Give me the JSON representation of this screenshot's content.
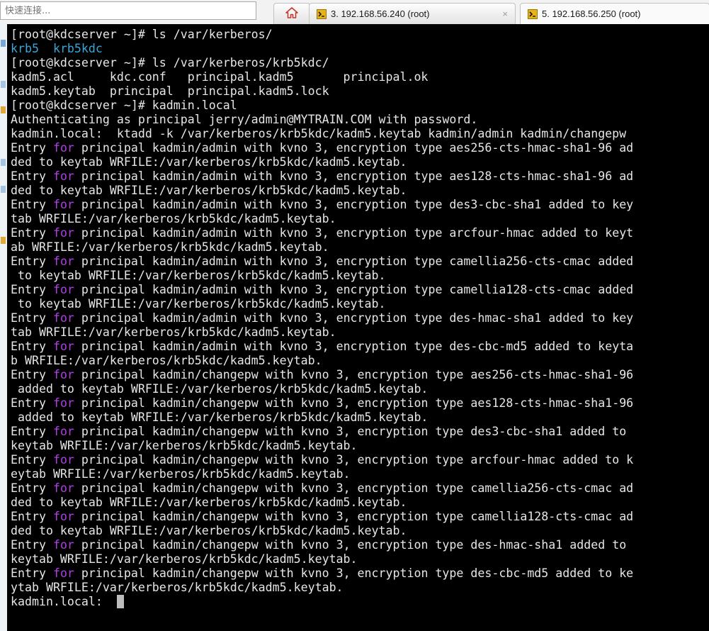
{
  "quick_connect": {
    "placeholder": "快速连接..."
  },
  "tabs": [
    {
      "label": "",
      "icon": "home-icon"
    },
    {
      "label": "3. 192.168.56.240 (root)",
      "icon": "terminal-tab-icon",
      "close": "×"
    },
    {
      "label": "5. 192.168.56.250 (root)",
      "icon": "terminal-tab-icon",
      "active": true
    }
  ],
  "terminal": {
    "lines": [
      [
        [
          "p",
          "[root@kdcserver ~]# ls /var/kerberos/"
        ]
      ],
      [
        [
          "d",
          "krb5"
        ],
        [
          "p",
          "  "
        ],
        [
          "d",
          "krb5kdc"
        ]
      ],
      [
        [
          "p",
          "[root@kdcserver ~]# ls /var/kerberos/krb5kdc/"
        ]
      ],
      [
        [
          "p",
          "kadm5.acl     kdc.conf   principal.kadm5       principal.ok"
        ]
      ],
      [
        [
          "p",
          "kadm5.keytab  principal  principal.kadm5.lock"
        ]
      ],
      [
        [
          "p",
          "[root@kdcserver ~]# kadmin.local"
        ]
      ],
      [
        [
          "p",
          "Authenticating as principal jerry/admin@MYTRAIN.COM with password."
        ]
      ],
      [
        [
          "p",
          "kadmin.local:  ktadd -k /var/kerberos/krb5kdc/kadm5.keytab kadmin/admin kadmin/changepw"
        ]
      ],
      [
        [
          "p",
          "Entry "
        ],
        [
          "k",
          "for"
        ],
        [
          "p",
          " principal kadmin/admin with kvno 3, encryption type aes256-cts-hmac-sha1-96 ad"
        ]
      ],
      [
        [
          "p",
          "ded to keytab WRFILE:/var/kerberos/krb5kdc/kadm5.keytab."
        ]
      ],
      [
        [
          "p",
          "Entry "
        ],
        [
          "k",
          "for"
        ],
        [
          "p",
          " principal kadmin/admin with kvno 3, encryption type aes128-cts-hmac-sha1-96 ad"
        ]
      ],
      [
        [
          "p",
          "ded to keytab WRFILE:/var/kerberos/krb5kdc/kadm5.keytab."
        ]
      ],
      [
        [
          "p",
          "Entry "
        ],
        [
          "k",
          "for"
        ],
        [
          "p",
          " principal kadmin/admin with kvno 3, encryption type des3-cbc-sha1 added to key"
        ]
      ],
      [
        [
          "p",
          "tab WRFILE:/var/kerberos/krb5kdc/kadm5.keytab."
        ]
      ],
      [
        [
          "p",
          "Entry "
        ],
        [
          "k",
          "for"
        ],
        [
          "p",
          " principal kadmin/admin with kvno 3, encryption type arcfour-hmac added to keyt"
        ]
      ],
      [
        [
          "p",
          "ab WRFILE:/var/kerberos/krb5kdc/kadm5.keytab."
        ]
      ],
      [
        [
          "p",
          "Entry "
        ],
        [
          "k",
          "for"
        ],
        [
          "p",
          " principal kadmin/admin with kvno 3, encryption type camellia256-cts-cmac added"
        ]
      ],
      [
        [
          "p",
          " to keytab WRFILE:/var/kerberos/krb5kdc/kadm5.keytab."
        ]
      ],
      [
        [
          "p",
          "Entry "
        ],
        [
          "k",
          "for"
        ],
        [
          "p",
          " principal kadmin/admin with kvno 3, encryption type camellia128-cts-cmac added"
        ]
      ],
      [
        [
          "p",
          " to keytab WRFILE:/var/kerberos/krb5kdc/kadm5.keytab."
        ]
      ],
      [
        [
          "p",
          "Entry "
        ],
        [
          "k",
          "for"
        ],
        [
          "p",
          " principal kadmin/admin with kvno 3, encryption type des-hmac-sha1 added to key"
        ]
      ],
      [
        [
          "p",
          "tab WRFILE:/var/kerberos/krb5kdc/kadm5.keytab."
        ]
      ],
      [
        [
          "p",
          "Entry "
        ],
        [
          "k",
          "for"
        ],
        [
          "p",
          " principal kadmin/admin with kvno 3, encryption type des-cbc-md5 added to keyta"
        ]
      ],
      [
        [
          "p",
          "b WRFILE:/var/kerberos/krb5kdc/kadm5.keytab."
        ]
      ],
      [
        [
          "p",
          "Entry "
        ],
        [
          "k",
          "for"
        ],
        [
          "p",
          " principal kadmin/changepw with kvno 3, encryption type aes256-cts-hmac-sha1-96"
        ]
      ],
      [
        [
          "p",
          " added to keytab WRFILE:/var/kerberos/krb5kdc/kadm5.keytab."
        ]
      ],
      [
        [
          "p",
          "Entry "
        ],
        [
          "k",
          "for"
        ],
        [
          "p",
          " principal kadmin/changepw with kvno 3, encryption type aes128-cts-hmac-sha1-96"
        ]
      ],
      [
        [
          "p",
          " added to keytab WRFILE:/var/kerberos/krb5kdc/kadm5.keytab."
        ]
      ],
      [
        [
          "p",
          "Entry "
        ],
        [
          "k",
          "for"
        ],
        [
          "p",
          " principal kadmin/changepw with kvno 3, encryption type des3-cbc-sha1 added to"
        ]
      ],
      [
        [
          "p",
          "keytab WRFILE:/var/kerberos/krb5kdc/kadm5.keytab."
        ]
      ],
      [
        [
          "p",
          "Entry "
        ],
        [
          "k",
          "for"
        ],
        [
          "p",
          " principal kadmin/changepw with kvno 3, encryption type arcfour-hmac added to k"
        ]
      ],
      [
        [
          "p",
          "eytab WRFILE:/var/kerberos/krb5kdc/kadm5.keytab."
        ]
      ],
      [
        [
          "p",
          "Entry "
        ],
        [
          "k",
          "for"
        ],
        [
          "p",
          " principal kadmin/changepw with kvno 3, encryption type camellia256-cts-cmac ad"
        ]
      ],
      [
        [
          "p",
          "ded to keytab WRFILE:/var/kerberos/krb5kdc/kadm5.keytab."
        ]
      ],
      [
        [
          "p",
          "Entry "
        ],
        [
          "k",
          "for"
        ],
        [
          "p",
          " principal kadmin/changepw with kvno 3, encryption type camellia128-cts-cmac ad"
        ]
      ],
      [
        [
          "p",
          "ded to keytab WRFILE:/var/kerberos/krb5kdc/kadm5.keytab."
        ]
      ],
      [
        [
          "p",
          "Entry "
        ],
        [
          "k",
          "for"
        ],
        [
          "p",
          " principal kadmin/changepw with kvno 3, encryption type des-hmac-sha1 added to"
        ]
      ],
      [
        [
          "p",
          "keytab WRFILE:/var/kerberos/krb5kdc/kadm5.keytab."
        ]
      ],
      [
        [
          "p",
          "Entry "
        ],
        [
          "k",
          "for"
        ],
        [
          "p",
          " principal kadmin/changepw with kvno 3, encryption type des-cbc-md5 added to ke"
        ]
      ],
      [
        [
          "p",
          "ytab WRFILE:/var/kerberos/krb5kdc/kadm5.keytab."
        ]
      ]
    ],
    "prompt": "kadmin.local:  "
  },
  "colors": {
    "background": "#000000",
    "text": "#e6e6e6",
    "directory": "#3aa6d8",
    "keyword": "#b33ee6",
    "cursor": "#bdbdbd"
  }
}
